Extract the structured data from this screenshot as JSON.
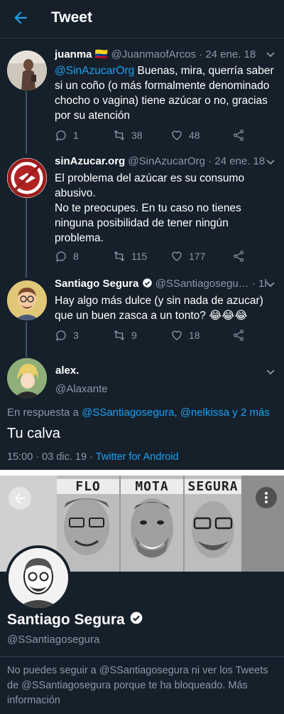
{
  "header": {
    "title": "Tweet"
  },
  "tweets": [
    {
      "name": "juanma",
      "flag": "🇨🇴",
      "handle": "@JuanmaofArcos",
      "date": "· 24 ene. 18",
      "mention": "@SinAzucarOrg",
      "text": "Buenas, mira, querría saber si un coño (o más formalmente denominado chocho o vagina) tiene azúcar o no, gracias por su atención",
      "replies": "1",
      "retweets": "38",
      "likes": "48"
    },
    {
      "name": "sinAzucar.org",
      "handle": "@SinAzucarOrg",
      "date": "· 24 ene. 18",
      "text": "El problema del azúcar es su consumo abusivo.\nNo te preocupes. En tu caso no tienes ninguna posibilidad de tener ningún problema.",
      "replies": "8",
      "retweets": "115",
      "likes": "177"
    },
    {
      "name": "Santiago Segura",
      "handle": "@SSantiagosegu…",
      "date": "· 1h",
      "text": "Hay algo más dulce (y sin nada de azucar) que un buen zasca a un tonto? 😂😂😂",
      "replies": "3",
      "retweets": "9",
      "likes": "18"
    }
  ],
  "main_tweet": {
    "name": "alex.",
    "handle": "@Alaxante",
    "reply_prefix": "En respuesta a",
    "reply_targets": "@SSantiagosegura, @nelkissa y 2 más",
    "text": "Tu calva",
    "time": "15:00 · 03 dic. 19 ·",
    "source": "Twitter for Android"
  },
  "profile": {
    "banner_labels": [
      "FLO",
      "MOTA",
      "SEGURA"
    ],
    "name": "Santiago Segura",
    "handle": "@SSantiagosegura",
    "blocked_message": "No puedes seguir a @SSantiagosegura ni ver los Tweets de @SSantiagosegura porque te ha bloqueado. Más información"
  },
  "colors": {
    "background": "#15202b",
    "accent": "#1da1f2",
    "muted": "#8899a6"
  },
  "icons": {
    "back": "back-arrow-icon",
    "reply": "reply-icon",
    "retweet": "retweet-icon",
    "like": "heart-icon",
    "share": "share-icon",
    "verified": "verified-badge-icon",
    "more": "more-vertical-icon"
  }
}
